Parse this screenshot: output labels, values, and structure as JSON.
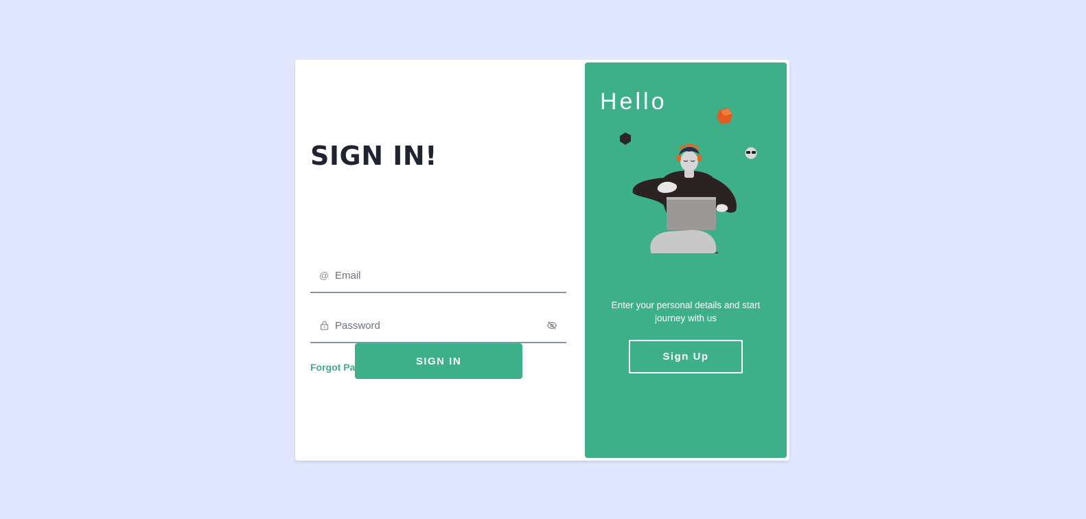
{
  "signin": {
    "title": "SIGN IN!",
    "email_placeholder": "Email",
    "password_placeholder": "Password",
    "forgot_label": "Forgot Password?",
    "button_label": "SIGN IN"
  },
  "panel": {
    "greeting": "Hello",
    "tagline": "Enter your personal details and start journey with us",
    "signup_label": "Sign Up"
  },
  "icons": {
    "email": "at-icon",
    "password": "lock-icon",
    "toggle": "eye-off-icon"
  },
  "colors": {
    "background": "#e0e7ff",
    "accent": "#3daf89",
    "title": "#1f2430",
    "underline": "#8594a8"
  }
}
